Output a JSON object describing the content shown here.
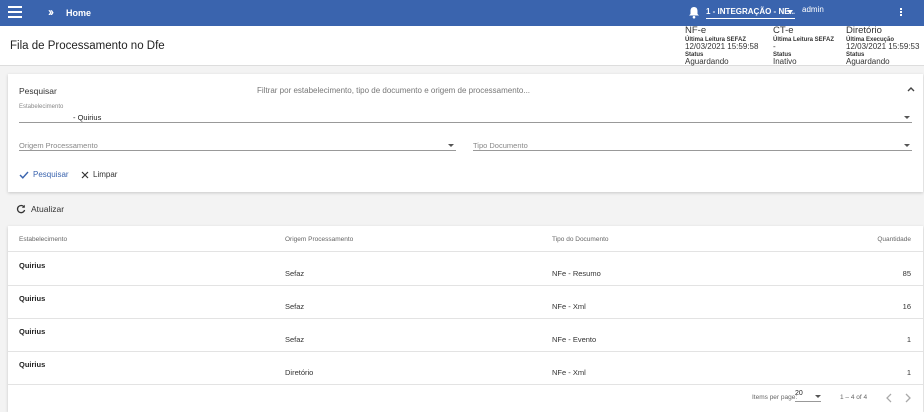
{
  "topbar": {
    "home_label": "Home",
    "company_select": "1 - INTEGRAÇÃO - NE...",
    "user": "admin"
  },
  "header": {
    "title": "Fila de Processamento no Dfe",
    "stats": [
      {
        "name": "NF-e",
        "label1": "Última Leitura SEFAZ",
        "value1": "12/03/2021 15:59:58",
        "label2": "Status",
        "value2": "Aguardando"
      },
      {
        "name": "CT-e",
        "label1": "Última Leitura SEFAZ",
        "value1": "-",
        "label2": "Status",
        "value2": "Inativo"
      },
      {
        "name": "Diretório",
        "label1": "Última Execução",
        "value1": "12/03/2021 15:59:53",
        "label2": "Status",
        "value2": "Aguardando"
      }
    ]
  },
  "search": {
    "header": "Pesquisar",
    "description": "Filtrar por estabelecimento, tipo de documento e origem de processamento...",
    "estabelecimento_label": "Estabelecimento",
    "estabelecimento_value": "- Quirius",
    "origem_placeholder": "Origem Processamento",
    "tipo_placeholder": "Tipo Documento",
    "search_button": "Pesquisar",
    "clear_button": "Limpar"
  },
  "refresh_label": "Atualizar",
  "table": {
    "columns": [
      "Estabelecimento",
      "Origem Processamento",
      "Tipo do Documento",
      "Quantidade"
    ],
    "rows": [
      {
        "estabelecimento": "Quirius",
        "origem": "Sefaz",
        "tipo": "NFe - Resumo",
        "quantidade": "85"
      },
      {
        "estabelecimento": "Quirius",
        "origem": "Sefaz",
        "tipo": "NFe - Xml",
        "quantidade": "16"
      },
      {
        "estabelecimento": "Quirius",
        "origem": "Sefaz",
        "tipo": "NFe - Evento",
        "quantidade": "1"
      },
      {
        "estabelecimento": "Quirius",
        "origem": "Diretório",
        "tipo": "NFe - Xml",
        "quantidade": "1"
      }
    ]
  },
  "paginator": {
    "items_label": "Items per page:",
    "page_size": "20",
    "range": "1 – 4 of 4"
  },
  "colors": {
    "primary": "#3a64ae",
    "background": "#f3f3f3"
  }
}
